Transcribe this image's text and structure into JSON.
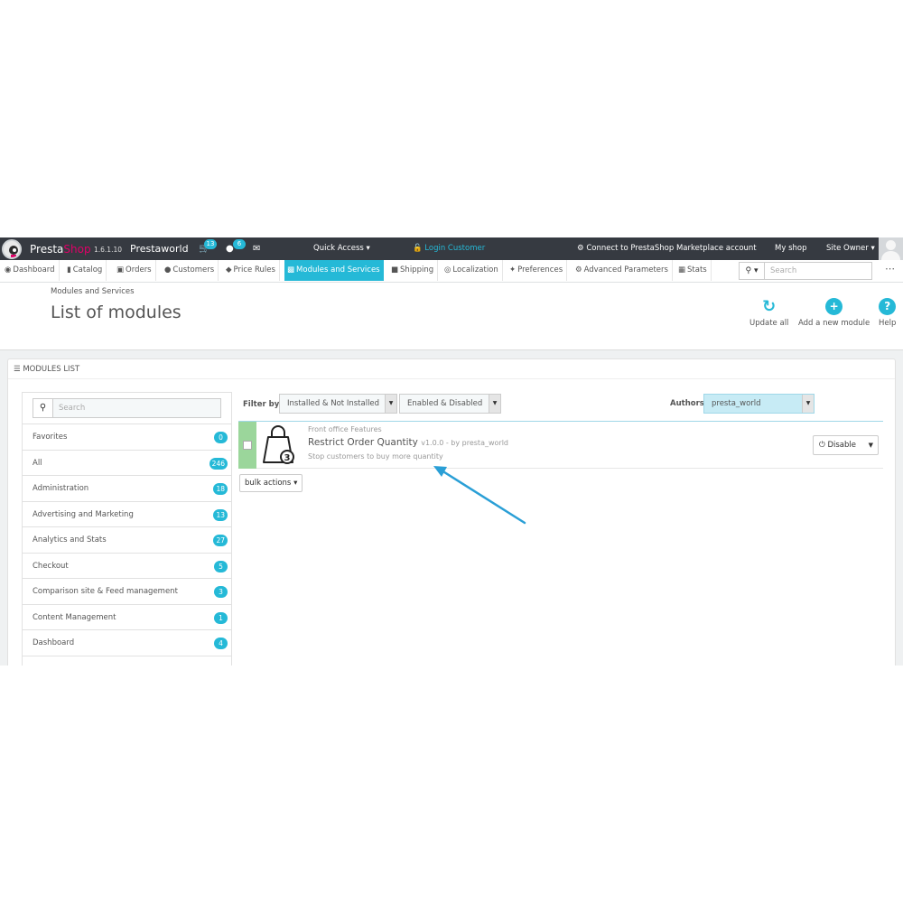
{
  "topbar": {
    "brand_presta": "Presta",
    "brand_shop": "Shop",
    "version": "1.6.1.10",
    "shop_name": "Prestaworld",
    "cart_badge": "13",
    "customers_badge": "6",
    "quick_access": "Quick Access",
    "login_customer": "Login Customer",
    "connect_marketplace": "Connect to PrestaShop Marketplace account",
    "my_shop": "My shop",
    "site_owner": "Site Owner"
  },
  "nav": {
    "items": [
      {
        "label": "Dashboard",
        "icon": "dashboard-icon"
      },
      {
        "label": "Catalog",
        "icon": "book-icon"
      },
      {
        "label": "Orders",
        "icon": "credit-card-icon"
      },
      {
        "label": "Customers",
        "icon": "users-icon"
      },
      {
        "label": "Price Rules",
        "icon": "tag-icon"
      },
      {
        "label": "Modules and Services",
        "icon": "puzzle-icon"
      },
      {
        "label": "Shipping",
        "icon": "truck-icon"
      },
      {
        "label": "Localization",
        "icon": "globe-icon"
      },
      {
        "label": "Preferences",
        "icon": "wrench-icon"
      },
      {
        "label": "Advanced Parameters",
        "icon": "cogs-icon"
      },
      {
        "label": "Stats",
        "icon": "bar-chart-icon"
      }
    ],
    "search_placeholder": "Search"
  },
  "header": {
    "breadcrumb": "Modules and Services",
    "title": "List of modules",
    "toolbar": {
      "update_all": "Update all",
      "add_module": "Add a new module",
      "help": "Help"
    }
  },
  "panel": {
    "heading": "MODULES LIST",
    "search_placeholder": "Search",
    "categories": [
      {
        "label": "Favorites",
        "count": "0"
      },
      {
        "label": "All",
        "count": "246"
      },
      {
        "label": "Administration",
        "count": "18"
      },
      {
        "label": "Advertising and Marketing",
        "count": "13"
      },
      {
        "label": "Analytics and Stats",
        "count": "27"
      },
      {
        "label": "Checkout",
        "count": "5"
      },
      {
        "label": "Comparison site & Feed management",
        "count": "3"
      },
      {
        "label": "Content Management",
        "count": "1"
      },
      {
        "label": "Dashboard",
        "count": "4"
      }
    ],
    "filter_by": "Filter by",
    "filter_install": "Installed & Not Installed",
    "filter_enabled": "Enabled & Disabled",
    "authors_label": "Authors",
    "authors_value": "presta_world",
    "module": {
      "category": "Front office Features",
      "name": "Restrict Order Quantity",
      "version": "v1.0.0 - by presta_world",
      "description": "Stop customers to buy more quantity",
      "action": "Disable"
    },
    "bulk_actions": "bulk actions"
  },
  "colors": {
    "accent": "#25b9d7",
    "topbar": "#363a41",
    "brand_pink": "#df0067",
    "enabled_green": "#9bd69b",
    "arrow": "#2a9fd6"
  }
}
